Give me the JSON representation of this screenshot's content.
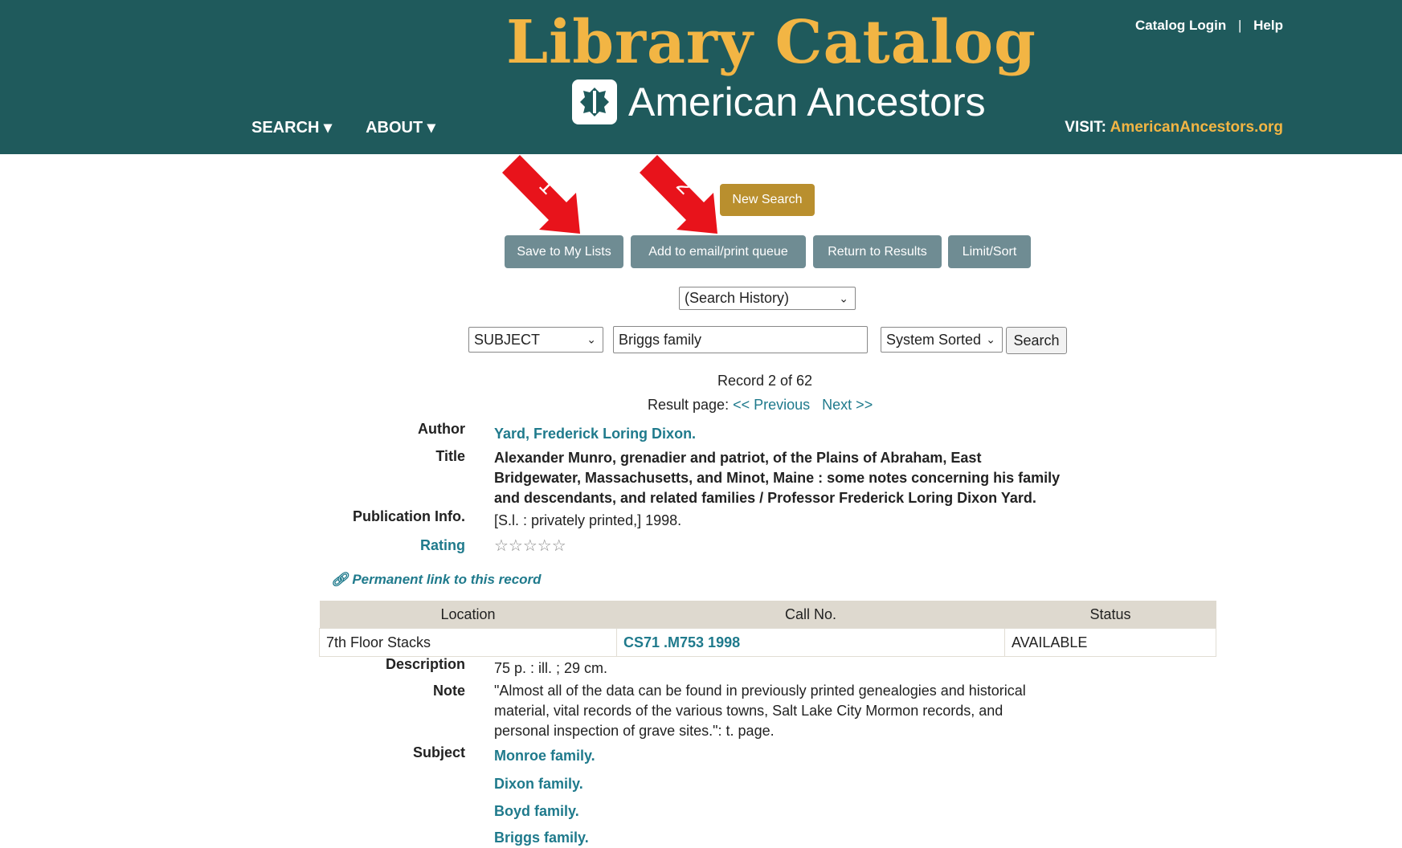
{
  "header": {
    "title": "Library Catalog",
    "subtitle": "American Ancestors",
    "nav": [
      {
        "label": "SEARCH ▾"
      },
      {
        "label": "ABOUT ▾"
      }
    ],
    "toplinks": {
      "login": "Catalog Login",
      "separator": "|",
      "help": "Help"
    },
    "visit": {
      "label": "VISIT:",
      "link": "AmericanAncestors.org"
    }
  },
  "annotations": {
    "arrow1": "1",
    "arrow2": "2",
    "color": "#e8131b"
  },
  "buttons": {
    "new_search": "New Search",
    "save_lists": "Save to My Lists",
    "email_print": "Add to email/print queue",
    "return_results": "Return to Results",
    "limit_sort": "Limit/Sort"
  },
  "search": {
    "history_select": "(Search History)",
    "field_select": "SUBJECT",
    "query": "Briggs family",
    "sort_select": "System Sorted",
    "search_button": "Search"
  },
  "record": {
    "position": "Record 2 of 62",
    "result_page_label": "Result page:",
    "previous": "<< Previous",
    "next": "Next >>",
    "author_label": "Author",
    "author": "Yard, Frederick Loring Dixon.",
    "title_label": "Title",
    "title_lines": [
      "Alexander Munro, grenadier and patriot, of the Plains of Abraham, East",
      "Bridgewater, Massachusetts, and Minot, Maine : some notes concerning his family",
      "and descendants, and related families / Professor Frederick Loring Dixon Yard."
    ],
    "pub_label": "Publication Info.",
    "publication": "[S.l. : privately printed,] 1998.",
    "rating_label": "Rating",
    "rating_stars": "☆☆☆☆☆",
    "permanent_link": "Permanent link to this record"
  },
  "holdings": {
    "headers": [
      "Location",
      "Call No.",
      "Status"
    ],
    "rows": [
      {
        "location": "7th Floor Stacks",
        "call_no": "CS71 .M753 1998",
        "status": "AVAILABLE"
      }
    ]
  },
  "details": {
    "description_label": "Description",
    "description": "75 p. : ill. ; 29 cm.",
    "note_label": "Note",
    "note_lines": [
      "\"Almost all of the data can be found in previously printed genealogies and historical",
      "material, vital records of the various towns, Salt Lake City Mormon records, and",
      "personal inspection of grave sites.\": t. page."
    ],
    "subject_label": "Subject",
    "subjects": [
      "Monroe family.",
      "Dixon family.",
      "Boyd family.",
      "Briggs family."
    ]
  }
}
